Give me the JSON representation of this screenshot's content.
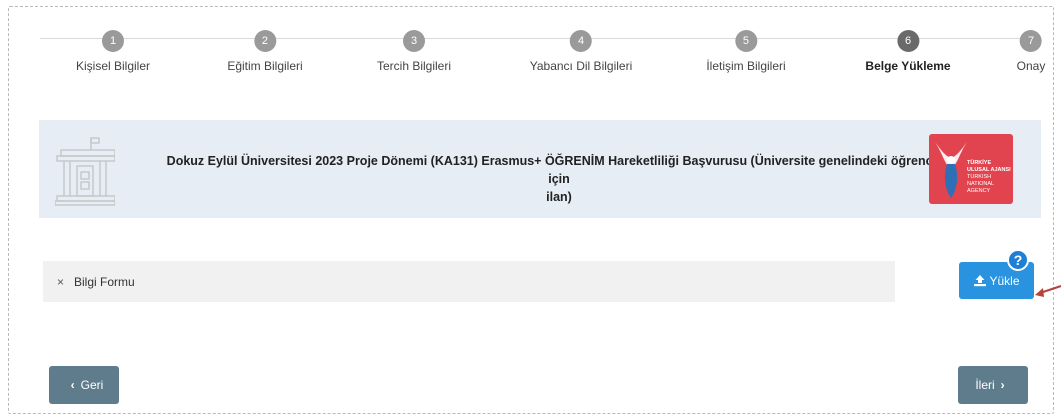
{
  "stepper": {
    "steps": [
      {
        "number": "1",
        "label": "Kişisel Bilgiler"
      },
      {
        "number": "2",
        "label": "Eğitim Bilgileri"
      },
      {
        "number": "3",
        "label": "Tercih Bilgileri"
      },
      {
        "number": "4",
        "label": "Yabancı Dil Bilgileri"
      },
      {
        "number": "5",
        "label": "İletişim Bilgileri"
      },
      {
        "number": "6",
        "label": "Belge Yükleme"
      },
      {
        "number": "7",
        "label": "Onay"
      }
    ],
    "active_step": "6"
  },
  "panel": {
    "title_line1": "Dokuz Eylül Üniversitesi 2023 Proje Dönemi (KA131) Erasmus+ ÖĞRENİM Hareketliliği Başvurusu (Üniversite genelindeki öğrenciler için",
    "title_line2": "ilan)",
    "logo_text_line1": "TÜRKİYE ULUSAL AJANSI",
    "logo_text_line2": "TURKISH NATIONAL AGENCY",
    "logo_color": "#e1434f"
  },
  "documents": {
    "items": [
      {
        "status_icon": "x-icon",
        "status_symbol": "×",
        "label": "Bilgi Formu"
      }
    ]
  },
  "upload": {
    "label": "Yükle",
    "icon": "upload-icon",
    "help_symbol": "?"
  },
  "nav": {
    "back_label": "Geri",
    "next_label": "İleri"
  },
  "colors": {
    "accent": "#2a93e0",
    "nav_button": "#5f7c8c",
    "panel_bg": "#e6edf5"
  }
}
